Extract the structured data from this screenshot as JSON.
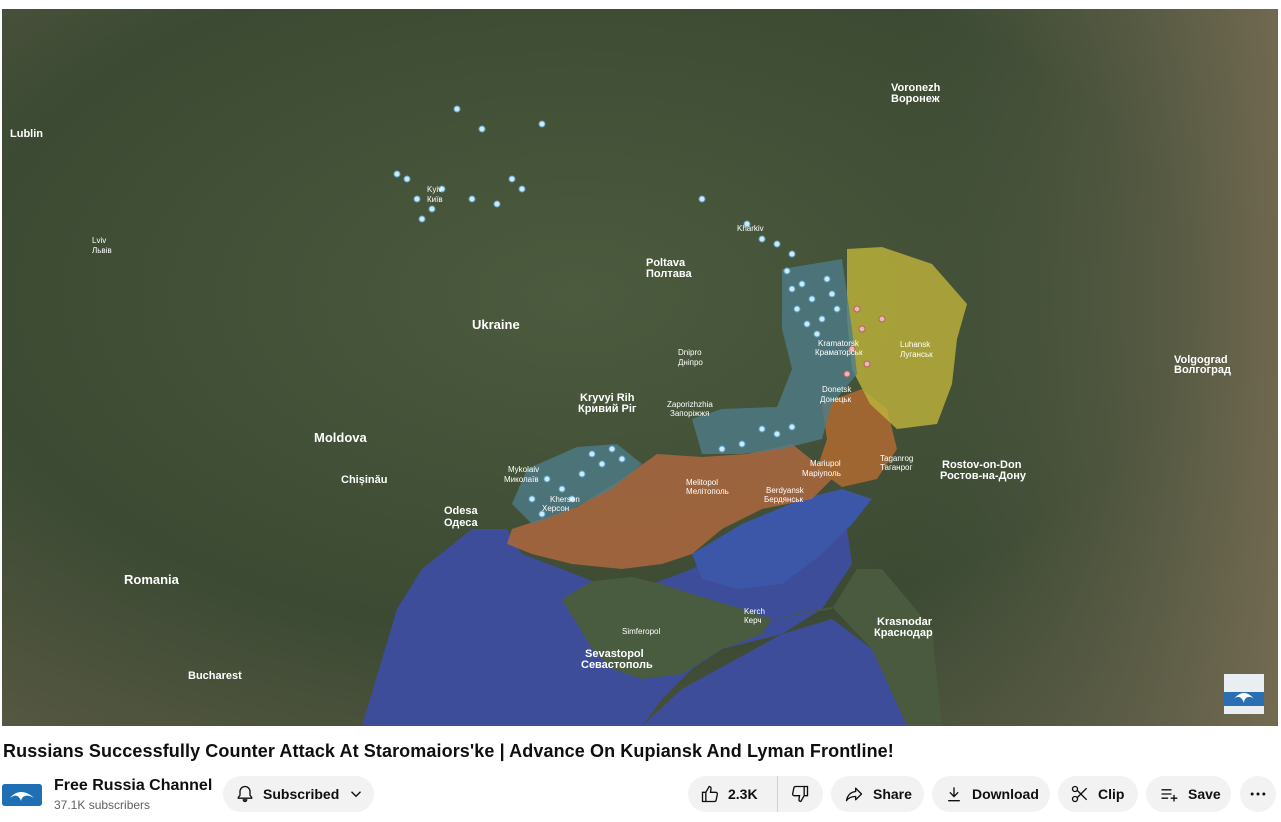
{
  "video": {
    "title": "Russians Successfully Counter Attack At Staromaiors'ke | Advance On Kupiansk And Lyman Frontline!"
  },
  "map": {
    "country_labels": [
      "Ukraine",
      "Moldova",
      "Romania"
    ],
    "city_labels": [
      "Kyiv",
      "Київ",
      "Kharkiv",
      "Lviv",
      "Львів",
      "Dnipro",
      "Дніпро",
      "Zaporizhzhia",
      "Запоріжжя",
      "Mykolaiv",
      "Миколаїв",
      "Kherson",
      "Херсон",
      "Odesa",
      "Одеса",
      "Mariupol",
      "Маріуполь",
      "Luhansk",
      "Луганськ",
      "Donetsk",
      "Донецьк",
      "Rostov-on-Don",
      "Ростов-на-Дону",
      "Sevastopol",
      "Севастополь",
      "Krasnodar",
      "Краснодар",
      "Voronezh",
      "Воронеж",
      "Volgograd",
      "Волгоград",
      "Chișinău",
      "Bucharest",
      "Lublin",
      "Melitopol",
      "Мелітополь",
      "Kramatorsk",
      "Краматорськ",
      "Berdyansk",
      "Бердянськ",
      "Poltava",
      "Полтава",
      "Kryvyi Rih",
      "Кривий Ріг",
      "Taganrog",
      "Таганрог",
      "Kerch",
      "Керч",
      "Simferopol"
    ],
    "colors": {
      "land": "#3f4d36",
      "sea": "#3d4d9a",
      "occupied_south": "#a8673f",
      "luhansk_zone": "#bdb23a",
      "donetsk_zone": "#b06a30",
      "contested_zone": "#4e7c8a",
      "marker_points": "#cfe9f6",
      "marker_red": "#e8b8b8"
    },
    "watermark_icon": "channel-logo-icon"
  },
  "channel": {
    "name": "Free Russia Channel",
    "subscribers": "37.1K subscribers"
  },
  "actions": {
    "subscribe_label": "Subscribed",
    "like_count": "2.3K",
    "share_label": "Share",
    "download_label": "Download",
    "clip_label": "Clip",
    "save_label": "Save"
  },
  "icons": {
    "bell": "bell-icon",
    "chevron": "chevron-down-icon",
    "like": "thumbs-up-icon",
    "dislike": "thumbs-down-icon",
    "share": "share-icon",
    "download": "download-icon",
    "clip": "scissors-icon",
    "save": "playlist-add-icon",
    "more": "more-horizontal-icon"
  }
}
